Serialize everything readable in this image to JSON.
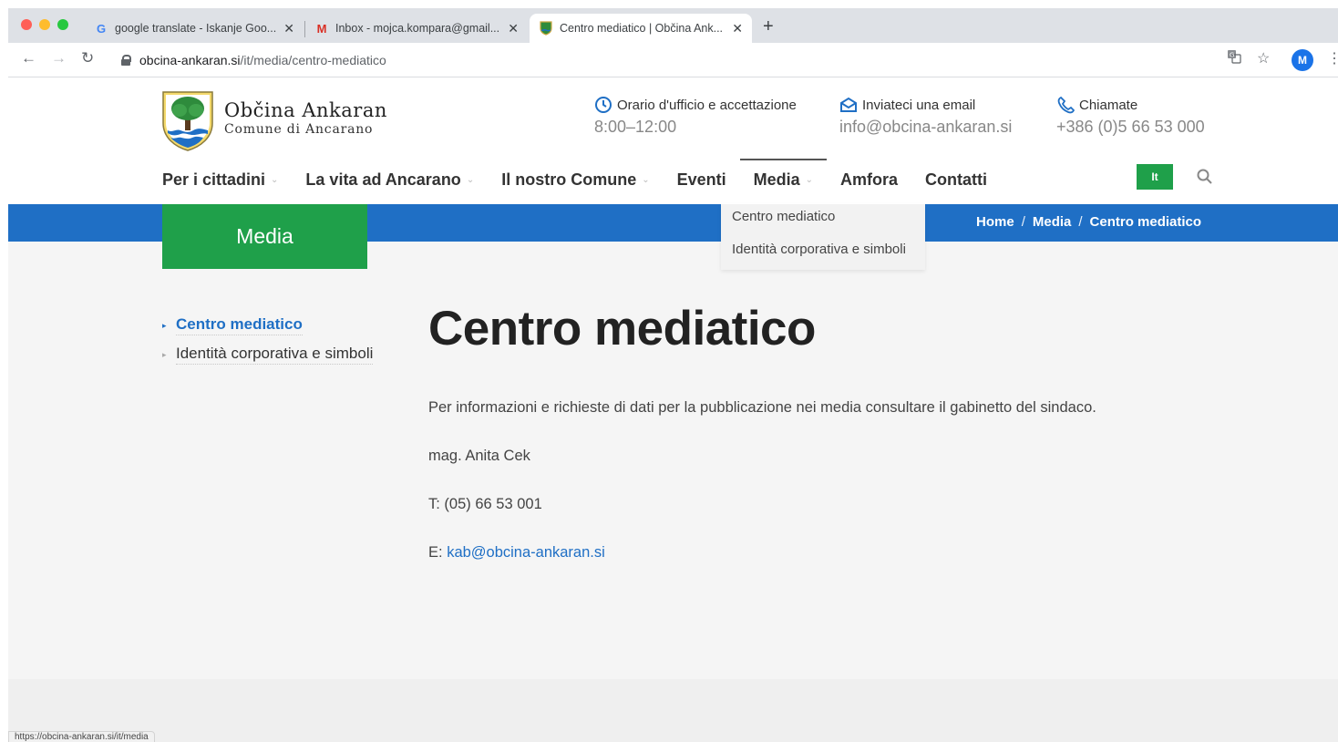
{
  "browser": {
    "tabs": [
      {
        "title": "google translate - Iskanje Goo...",
        "icon": "google-g-icon"
      },
      {
        "title": "Inbox - mojca.kompara@gmail...",
        "icon": "gmail-icon"
      },
      {
        "title": "Centro mediatico | Občina Ank...",
        "icon": "coat-of-arms-icon"
      }
    ],
    "url_host": "obcina-ankaran.si",
    "url_path": "/it/media/centro-mediatico",
    "avatar_letter": "M",
    "status_url": "https://obcina-ankaran.si/it/media"
  },
  "site": {
    "logo_title": "Občina Ankaran",
    "logo_subtitle": "Comune di Ancarano",
    "info": {
      "hours_label": "Orario d'ufficio e accettazione",
      "hours_value": "8:00–12:00",
      "email_label": "Inviateci una email",
      "email_value": "info@obcina-ankaran.si",
      "phone_label": "Chiamate",
      "phone_value": "+386 (0)5 66 53 000"
    },
    "nav": [
      {
        "label": "Per i cittadini",
        "has_caret": true
      },
      {
        "label": "La vita ad Ancarano",
        "has_caret": true
      },
      {
        "label": "Il nostro Comune",
        "has_caret": true
      },
      {
        "label": "Eventi",
        "has_caret": false
      },
      {
        "label": "Media",
        "has_caret": true
      },
      {
        "label": "Amfora",
        "has_caret": false
      },
      {
        "label": "Contatti",
        "has_caret": false
      }
    ],
    "lang_button": "It",
    "dropdown": [
      "Centro mediatico",
      "Identità corporativa e simboli"
    ],
    "section_title": "Media",
    "breadcrumb": [
      "Home",
      "Media",
      "Centro mediatico"
    ],
    "sidenav": [
      "Centro mediatico",
      "Identità corporativa e simboli"
    ],
    "page_title": "Centro mediatico",
    "intro": "Per informazioni e richieste di dati per la pubblicazione nei media consultare il gabinetto del sindaco.",
    "contact_name": "mag. Anita Cek",
    "contact_phone": "T: (05) 66 53 001",
    "contact_email_prefix": "E: ",
    "contact_email": "kab@obcina-ankaran.si"
  },
  "colors": {
    "blue": "#1f6fc5",
    "green": "#1fa04a"
  }
}
